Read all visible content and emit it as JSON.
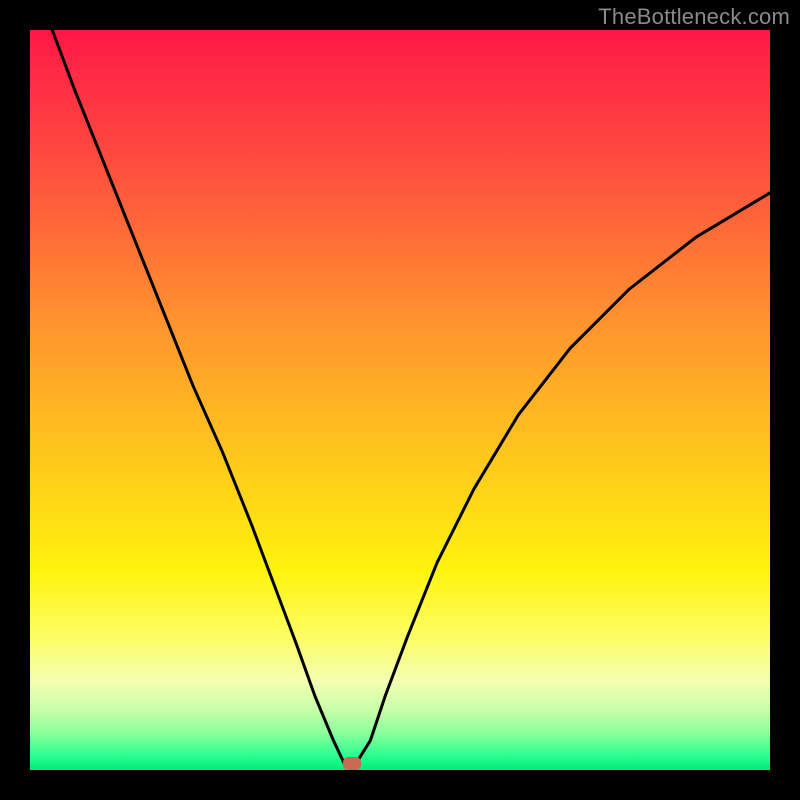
{
  "watermark": "TheBottleneck.com",
  "chart_data": {
    "type": "line",
    "title": "",
    "xlabel": "",
    "ylabel": "",
    "xlim": [
      0,
      100
    ],
    "ylim": [
      0,
      100
    ],
    "background_gradient": {
      "top_color": "#ff1846",
      "mid_color": "#ffd318",
      "bottom_color": "#02e97b",
      "meaning": "red=high bottleneck, green=no bottleneck"
    },
    "series": [
      {
        "name": "bottleneck-curve",
        "comment": "V-shaped curve; y is bottleneck percentage vs an implicit x parameter. Values approximated from plotted pixels.",
        "x": [
          3,
          6,
          10,
          14,
          18,
          22,
          26,
          30,
          33,
          36,
          38.5,
          41,
          42.5,
          44,
          46,
          48,
          51,
          55,
          60,
          66,
          73,
          81,
          90,
          100
        ],
        "y": [
          100,
          92,
          82,
          72,
          62,
          52,
          43,
          33,
          25,
          17,
          10,
          4,
          0.8,
          0.8,
          4,
          10,
          18,
          28,
          38,
          48,
          57,
          65,
          72,
          78
        ]
      }
    ],
    "marker": {
      "comment": "Small rounded marker near curve minimum",
      "x": 43.5,
      "y": 0.8,
      "color": "#c96a55"
    },
    "grid": false,
    "legend": false
  },
  "colors": {
    "frame": "#000000",
    "curve": "#000000",
    "watermark": "#8a8a8a"
  }
}
